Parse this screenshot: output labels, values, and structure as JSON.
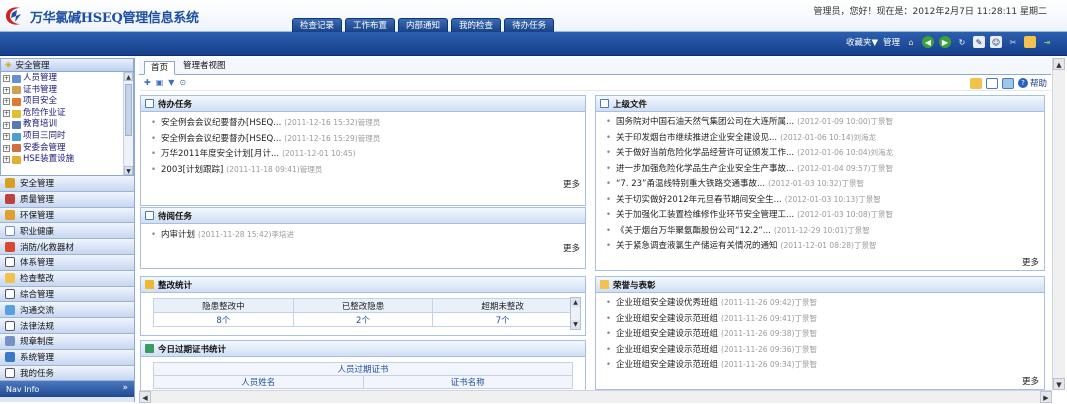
{
  "header": {
    "app_title": "万华氯碱HSEQ管理信息系统",
    "user_info": "管理员，您好！现在是：2012年2月7日 11:28:11 星期二",
    "tabs": [
      "检查记录",
      "工作布置",
      "内部通知",
      "我的检查",
      "待办任务"
    ]
  },
  "toolbar": {
    "favorites": "收藏夹▼",
    "manage": "管理",
    "icons": [
      "home-icon",
      "back-icon",
      "forward-icon",
      "refresh-icon",
      "edit-icon",
      "user-icon",
      "tools-icon",
      "folder-icon",
      "exit-icon"
    ]
  },
  "sidebar": {
    "tree_header": "安全管理",
    "tree_items": [
      "人员管理",
      "证书管理",
      "项目安全",
      "危险作业证",
      "教育培训",
      "项目三同时",
      "安委会管理",
      "HSE装置设施"
    ],
    "menu": [
      "安全管理",
      "质量管理",
      "环保管理",
      "职业健康",
      "消防/化救器材",
      "体系管理",
      "检查整改",
      "综合管理",
      "沟通交流",
      "法律法规",
      "规章制度",
      "系统管理",
      "我的任务"
    ],
    "bottom": "Nav Info"
  },
  "main": {
    "tabs": [
      "首页",
      "管理者视图"
    ],
    "help": "帮助",
    "more": "更多",
    "todo": {
      "title": "待办任务",
      "items": [
        {
          "text": "安全例会会议纪要督办[HSEQ...",
          "meta": "(2011-12-16 15:32)管理员"
        },
        {
          "text": "安全例会会议纪要督办[HSEQ...",
          "meta": "(2011-12-16 15:29)管理员"
        },
        {
          "text": "万华2011年度安全计划[月计...",
          "meta": "(2011-12-01 10:45)"
        },
        {
          "text": "2003[计划跟踪]",
          "meta": "(2011-11-18 09:41)管理员"
        }
      ]
    },
    "toread": {
      "title": "待阅任务",
      "items": [
        {
          "text": "内审计划",
          "meta": "(2011-11-28 15:42)李培进"
        }
      ]
    },
    "rectify": {
      "title": "整改统计",
      "headers": [
        "隐患整改中",
        "已整改隐患",
        "超期未整改"
      ],
      "values": [
        "8个",
        "2个",
        "7个"
      ]
    },
    "certs": {
      "title": "今日过期证书统计",
      "caption": "人员过期证书",
      "headers": [
        "人员姓名",
        "证书名称"
      ]
    },
    "docs": {
      "title": "上级文件",
      "items": [
        {
          "text": "国务院对中国石油天然气集团公司在大连所属...",
          "meta": "(2012-01-09 10:00)丁景智"
        },
        {
          "text": "关于印发烟台市继续推进企业安全建设见...",
          "meta": "(2012-01-06 10:14)刘海龙"
        },
        {
          "text": "关于做好当前危险化学品经营许可证颁发工作...",
          "meta": "(2012-01-06 10:04)刘海龙"
        },
        {
          "text": "进一步加强危险化学品生产企业安全生产事故...",
          "meta": "(2012-01-04 09:57)丁景智"
        },
        {
          "text": "“7. 23”甬温线特别重大铁路交通事故...",
          "meta": "(2012-01-03 10:32)丁景智"
        },
        {
          "text": "关于切实做好2012年元旦春节期间安全生...",
          "meta": "(2012-01-03 10:13)丁景智"
        },
        {
          "text": "关于加强化工装置检维修作业环节安全管理工...",
          "meta": "(2012-01-03 10:08)丁景智"
        },
        {
          "text": "《关于烟台万华聚氨酯股份公司“12.2”...",
          "meta": "(2011-12-29 10:01)丁景智"
        },
        {
          "text": "关于紧急调查液氯生产储运有关情况的通知",
          "meta": "(2011-12-01 08:28)丁景智"
        }
      ]
    },
    "honors": {
      "title": "荣誉与表彰",
      "items": [
        {
          "text": "企业班组安全建设优秀班组",
          "meta": "(2011-11-26 09:42)丁景智"
        },
        {
          "text": "企业班组安全建设示范班组",
          "meta": "(2011-11-26 09:41)丁景智"
        },
        {
          "text": "企业班组安全建设示范班组",
          "meta": "(2011-11-26 09:38)丁景智"
        },
        {
          "text": "企业班组安全建设示范班组",
          "meta": "(2011-11-26 09:36)丁景智"
        },
        {
          "text": "企业班组安全建设示范班组",
          "meta": "(2011-11-26 09:34)丁景智"
        }
      ]
    }
  },
  "colors": {
    "header_blue": "#1d4fa3",
    "toolbar_blue": "#163f8b",
    "panel_border": "#a9bfe2"
  }
}
